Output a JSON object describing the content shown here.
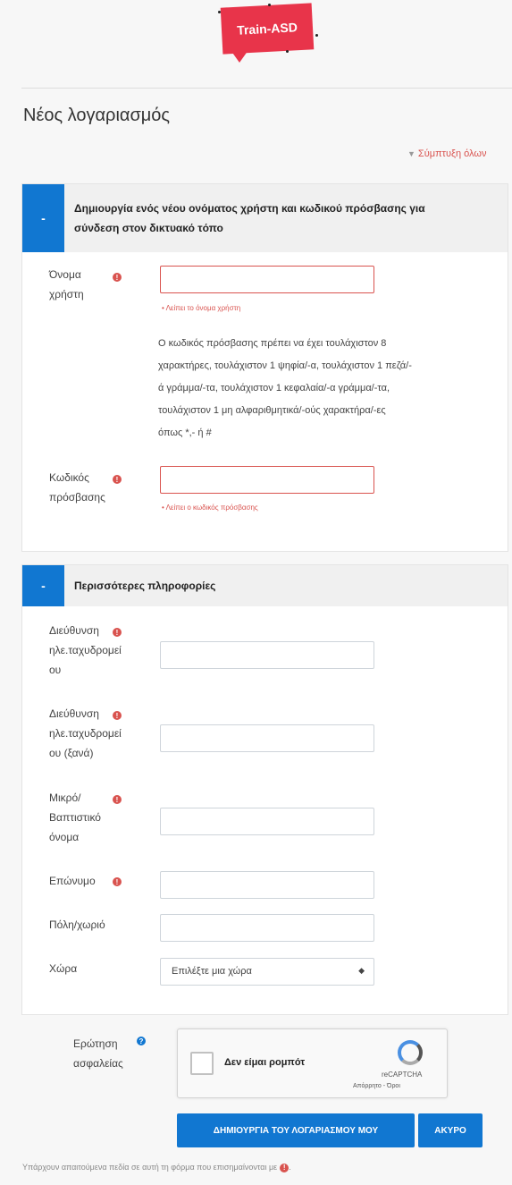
{
  "brand": {
    "logo_text": "Train-ASD",
    "logo_color": "#e8344a"
  },
  "page_title": "Νέος λογαριασμός",
  "collapse_all": "Σύμπτυξη όλων",
  "colors": {
    "accent": "#1177d1",
    "error": "#d9534f"
  },
  "section1": {
    "toggle": "-",
    "title_line1": "Δημιουργία ενός νέου ονόματος χρήστη και κωδικού πρόσβασης για",
    "title_line2": "σύνδεση στον δικτυακό τόπο",
    "username": {
      "label_line1": "Όνομα",
      "label_line2": "χρήστη",
      "value": "",
      "error": "• Λείπει το όνομα χρήστη"
    },
    "password_rules": [
      "Ο κωδικός πρόσβασης πρέπει να έχει τουλάχιστον 8",
      "χαρακτήρες, τουλάχιστον 1 ψηφία/-α, τουλάχιστον 1 πεζά/-",
      "ά γράμμα/-τα, τουλάχιστον 1 κεφαλαία/-α γράμμα/-τα,",
      "τουλάχιστον 1 μη αλφαριθμητικά/-ούς χαρακτήρα/-ες",
      "όπως *,- ή #"
    ],
    "password": {
      "label_line1": "Κωδικός",
      "label_line2": "πρόσβασης",
      "value": "",
      "error": "• Λείπει ο κωδικός πρόσβασης"
    }
  },
  "section2": {
    "toggle": "-",
    "title": "Περισσότερες πληροφορίες",
    "email": {
      "label_line1": "Διεύθυνση",
      "label_line2": "ηλε.ταχυδρομεί",
      "label_line3": "ου",
      "value": ""
    },
    "email2": {
      "label_line1": "Διεύθυνση",
      "label_line2": "ηλε.ταχυδρομεί",
      "label_line3": "ου (ξανά)",
      "value": ""
    },
    "firstname": {
      "label_line1": "Μικρό/",
      "label_line2": "Βαπτιστικό",
      "label_line3": "όνομα",
      "value": ""
    },
    "lastname": {
      "label": "Επώνυμο",
      "value": ""
    },
    "city": {
      "label": "Πόλη/χωριό",
      "value": ""
    },
    "country": {
      "label": "Χώρα",
      "selected": "Επιλέξτε μια χώρα"
    }
  },
  "security": {
    "label_line1": "Ερώτηση",
    "label_line2": "ασφαλείας",
    "captcha_label": "Δεν είμαι ρομπότ",
    "captcha_brand": "reCAPTCHA",
    "captcha_terms": "Απόρρητο - Όροι"
  },
  "buttons": {
    "create": "ΔΗΜΙΟΥΡΓΙΑ ΤΟΥ ΛΟΓΑΡΙΑΣΜΟΥ ΜΟΥ",
    "cancel": "ΑΚΥΡΟ"
  },
  "footer_note": "Υπάρχουν απαιτούμενα πεδία σε αυτή τη φόρμα που επισημαίνονται με",
  "footer_end": "."
}
